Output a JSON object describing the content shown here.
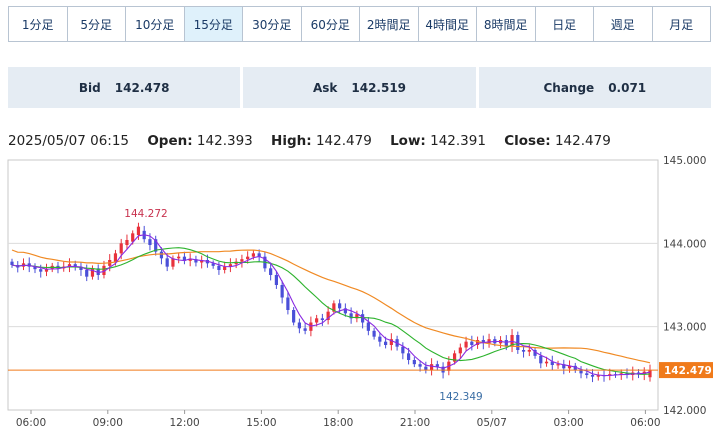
{
  "timeframes": [
    {
      "label": "1分足",
      "active": false
    },
    {
      "label": "5分足",
      "active": false
    },
    {
      "label": "10分足",
      "active": false
    },
    {
      "label": "15分足",
      "active": true
    },
    {
      "label": "30分足",
      "active": false
    },
    {
      "label": "60分足",
      "active": false
    },
    {
      "label": "2時間足",
      "active": false
    },
    {
      "label": "4時間足",
      "active": false
    },
    {
      "label": "8時間足",
      "active": false
    },
    {
      "label": "日足",
      "active": false
    },
    {
      "label": "週足",
      "active": false
    },
    {
      "label": "月足",
      "active": false
    }
  ],
  "quotes": {
    "bid_label": "Bid",
    "bid_value": "142.478",
    "ask_label": "Ask",
    "ask_value": "142.519",
    "change_label": "Change",
    "change_value": "0.071"
  },
  "ohlc": {
    "datetime": "2025/05/07 06:15",
    "open_label": "Open:",
    "open": "142.393",
    "high_label": "High:",
    "high": "142.479",
    "low_label": "Low:",
    "low": "142.391",
    "close_label": "Close:",
    "close": "142.479"
  },
  "chart_data": {
    "type": "candlestick",
    "y_ticks": [
      "145.000",
      "144.000",
      "143.000",
      "142.000"
    ],
    "ylim": [
      142.0,
      145.0
    ],
    "x_ticks": [
      "06:00",
      "09:00",
      "12:00",
      "15:00",
      "18:00",
      "21:00",
      "05/07",
      "03:00",
      "06:00"
    ],
    "high_annotation": "144.272",
    "low_annotation": "142.349",
    "current_price_label": "142.479",
    "colors": {
      "up": "#e8323c",
      "down": "#4a4fd8",
      "ma_short": "#8a2be2",
      "ma_mid": "#2db32d",
      "ma_long": "#f08a24",
      "price_line": "#f07a1a",
      "annotation_high": "#c8324e",
      "annotation_low": "#3a6ea5"
    },
    "candles": [
      {
        "o": 143.78,
        "c": 143.74
      },
      {
        "o": 143.74,
        "c": 143.71
      },
      {
        "o": 143.72,
        "c": 143.76
      },
      {
        "o": 143.76,
        "c": 143.72
      },
      {
        "o": 143.72,
        "c": 143.69
      },
      {
        "o": 143.69,
        "c": 143.66
      },
      {
        "o": 143.66,
        "c": 143.69
      },
      {
        "o": 143.69,
        "c": 143.73
      },
      {
        "o": 143.73,
        "c": 143.7
      },
      {
        "o": 143.7,
        "c": 143.72
      },
      {
        "o": 143.72,
        "c": 143.75
      },
      {
        "o": 143.75,
        "c": 143.72
      },
      {
        "o": 143.72,
        "c": 143.68
      },
      {
        "o": 143.68,
        "c": 143.6
      },
      {
        "o": 143.6,
        "c": 143.7
      },
      {
        "o": 143.7,
        "c": 143.62
      },
      {
        "o": 143.62,
        "c": 143.73
      },
      {
        "o": 143.73,
        "c": 143.8
      },
      {
        "o": 143.78,
        "c": 143.88
      },
      {
        "o": 143.88,
        "c": 144.0
      },
      {
        "o": 143.98,
        "c": 144.04
      },
      {
        "o": 144.02,
        "c": 144.12
      },
      {
        "o": 144.1,
        "c": 144.2
      },
      {
        "o": 144.15,
        "c": 144.05
      },
      {
        "o": 144.05,
        "c": 143.98
      },
      {
        "o": 144.05,
        "c": 143.9
      },
      {
        "o": 143.9,
        "c": 143.82
      },
      {
        "o": 143.82,
        "c": 143.72
      },
      {
        "o": 143.72,
        "c": 143.82
      },
      {
        "o": 143.82,
        "c": 143.84
      },
      {
        "o": 143.84,
        "c": 143.79
      },
      {
        "o": 143.79,
        "c": 143.81
      },
      {
        "o": 143.81,
        "c": 143.77
      },
      {
        "o": 143.77,
        "c": 143.8
      },
      {
        "o": 143.8,
        "c": 143.76
      },
      {
        "o": 143.76,
        "c": 143.73
      },
      {
        "o": 143.73,
        "c": 143.68
      },
      {
        "o": 143.68,
        "c": 143.72
      },
      {
        "o": 143.72,
        "c": 143.75
      },
      {
        "o": 143.75,
        "c": 143.78
      },
      {
        "o": 143.78,
        "c": 143.81
      },
      {
        "o": 143.81,
        "c": 143.84
      },
      {
        "o": 143.84,
        "c": 143.88
      },
      {
        "o": 143.88,
        "c": 143.84
      },
      {
        "o": 143.84,
        "c": 143.7
      },
      {
        "o": 143.7,
        "c": 143.62
      },
      {
        "o": 143.62,
        "c": 143.5
      },
      {
        "o": 143.5,
        "c": 143.35
      },
      {
        "o": 143.35,
        "c": 143.2
      },
      {
        "o": 143.2,
        "c": 143.05
      },
      {
        "o": 143.05,
        "c": 142.98
      },
      {
        "o": 142.98,
        "c": 142.95
      },
      {
        "o": 142.95,
        "c": 143.05
      },
      {
        "o": 143.05,
        "c": 143.1
      },
      {
        "o": 143.1,
        "c": 143.08
      },
      {
        "o": 143.08,
        "c": 143.18
      },
      {
        "o": 143.18,
        "c": 143.28
      },
      {
        "o": 143.28,
        "c": 143.22
      },
      {
        "o": 143.22,
        "c": 143.16
      },
      {
        "o": 143.16,
        "c": 143.1
      },
      {
        "o": 143.1,
        "c": 143.15
      },
      {
        "o": 143.15,
        "c": 143.05
      },
      {
        "o": 143.05,
        "c": 142.95
      },
      {
        "o": 142.95,
        "c": 142.88
      },
      {
        "o": 142.88,
        "c": 142.82
      },
      {
        "o": 142.82,
        "c": 142.78
      },
      {
        "o": 142.78,
        "c": 142.85
      },
      {
        "o": 142.85,
        "c": 142.76
      },
      {
        "o": 142.76,
        "c": 142.68
      },
      {
        "o": 142.68,
        "c": 142.6
      },
      {
        "o": 142.6,
        "c": 142.55
      },
      {
        "o": 142.55,
        "c": 142.52
      },
      {
        "o": 142.52,
        "c": 142.48
      },
      {
        "o": 142.48,
        "c": 142.55
      },
      {
        "o": 142.55,
        "c": 142.52
      },
      {
        "o": 142.52,
        "c": 142.45
      },
      {
        "o": 142.47,
        "c": 142.58
      },
      {
        "o": 142.58,
        "c": 142.68
      },
      {
        "o": 142.68,
        "c": 142.75
      },
      {
        "o": 142.75,
        "c": 142.82
      },
      {
        "o": 142.82,
        "c": 142.78
      },
      {
        "o": 142.78,
        "c": 142.84
      },
      {
        "o": 142.84,
        "c": 142.8
      },
      {
        "o": 142.8,
        "c": 142.85
      },
      {
        "o": 142.85,
        "c": 142.8
      },
      {
        "o": 142.8,
        "c": 142.84
      },
      {
        "o": 142.84,
        "c": 142.76
      },
      {
        "o": 142.76,
        "c": 142.9
      },
      {
        "o": 142.9,
        "c": 142.72
      },
      {
        "o": 142.72,
        "c": 142.7
      },
      {
        "o": 142.7,
        "c": 142.72
      },
      {
        "o": 142.72,
        "c": 142.65
      },
      {
        "o": 142.65,
        "c": 142.56
      },
      {
        "o": 142.56,
        "c": 142.58
      },
      {
        "o": 142.58,
        "c": 142.54
      },
      {
        "o": 142.54,
        "c": 142.55
      },
      {
        "o": 142.55,
        "c": 142.5
      },
      {
        "o": 142.5,
        "c": 142.53
      },
      {
        "o": 142.53,
        "c": 142.48
      },
      {
        "o": 142.48,
        "c": 142.44
      },
      {
        "o": 142.44,
        "c": 142.42
      },
      {
        "o": 142.42,
        "c": 142.4
      },
      {
        "o": 142.4,
        "c": 142.42
      },
      {
        "o": 142.42,
        "c": 142.41
      },
      {
        "o": 142.41,
        "c": 142.43
      },
      {
        "o": 142.43,
        "c": 142.42
      },
      {
        "o": 142.42,
        "c": 142.44
      },
      {
        "o": 142.44,
        "c": 142.42
      },
      {
        "o": 142.42,
        "c": 142.45
      },
      {
        "o": 142.45,
        "c": 142.43
      },
      {
        "o": 142.43,
        "c": 142.46
      },
      {
        "o": 142.393,
        "c": 142.479
      }
    ]
  }
}
